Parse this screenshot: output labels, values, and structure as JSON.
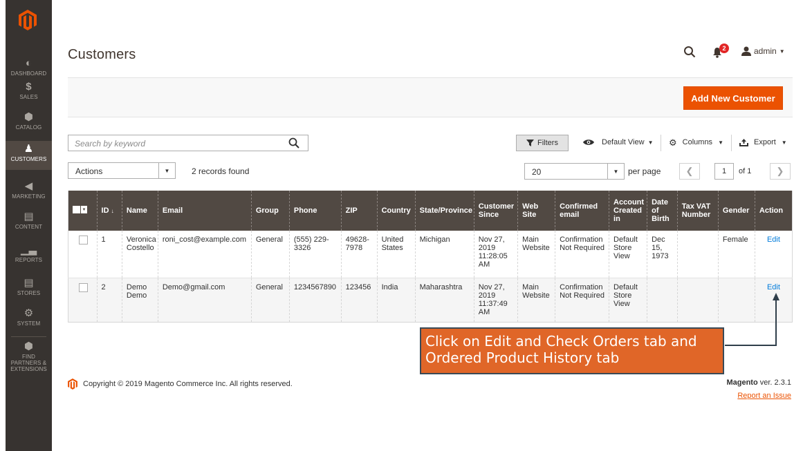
{
  "sidebar": {
    "items": [
      {
        "label": "DASHBOARD",
        "icon": "dashboard-icon"
      },
      {
        "label": "SALES",
        "icon": "dollar-icon"
      },
      {
        "label": "CATALOG",
        "icon": "cube-icon"
      },
      {
        "label": "CUSTOMERS",
        "icon": "person-icon"
      },
      {
        "label": "MARKETING",
        "icon": "megaphone-icon"
      },
      {
        "label": "CONTENT",
        "icon": "layout-icon"
      },
      {
        "label": "REPORTS",
        "icon": "bar-chart-icon"
      },
      {
        "label": "STORES",
        "icon": "storefront-icon"
      },
      {
        "label": "SYSTEM",
        "icon": "gear-icon"
      },
      {
        "label": "FIND PARTNERS & EXTENSIONS",
        "icon": "box-icon"
      }
    ]
  },
  "header": {
    "title": "Customers",
    "notification_count": "2",
    "user": "admin"
  },
  "actions": {
    "add_new": "Add New Customer"
  },
  "toolbar": {
    "search_placeholder": "Search by keyword",
    "filters": "Filters",
    "default_view": "Default View",
    "columns": "Columns",
    "export": "Export",
    "mass_actions": "Actions",
    "records_found": "2 records found",
    "per_page_value": "20",
    "per_page_label": "per page",
    "page_current": "1",
    "page_of": "of 1"
  },
  "grid": {
    "columns": [
      "ID",
      "Name",
      "Email",
      "Group",
      "Phone",
      "ZIP",
      "Country",
      "State/Province",
      "Customer Since",
      "Web Site",
      "Confirmed email",
      "Account Created in",
      "Date of Birth",
      "Tax VAT Number",
      "Gender",
      "Action"
    ],
    "rows": [
      {
        "id": "1",
        "name": "Veronica Costello",
        "email": "roni_cost@example.com",
        "group": "General",
        "phone": "(555) 229-3326",
        "zip": "49628-7978",
        "country": "United States",
        "state": "Michigan",
        "since": "Nov 27, 2019 11:28:05 AM",
        "website": "Main Website",
        "confirmed": "Confirmation Not Required",
        "created_in": "Default Store View",
        "dob": "Dec 15, 1973",
        "taxvat": "",
        "gender": "Female",
        "action": "Edit"
      },
      {
        "id": "2",
        "name": "Demo Demo",
        "email": "Demo@gmail.com",
        "group": "General",
        "phone": "1234567890",
        "zip": "123456",
        "country": "India",
        "state": "Maharashtra",
        "since": "Nov 27, 2019 11:37:49 AM",
        "website": "Main Website",
        "confirmed": "Confirmation Not Required",
        "created_in": "Default Store View",
        "dob": "",
        "taxvat": "",
        "gender": "",
        "action": "Edit"
      }
    ]
  },
  "callout": {
    "text": "Click on Edit and Check Orders tab and Ordered Product History tab"
  },
  "footer": {
    "copyright": "Copyright © 2019 Magento Commerce Inc. All rights reserved.",
    "brand": "Magento",
    "version": " ver. 2.3.1",
    "report": "Report an Issue"
  },
  "colors": {
    "accent": "#eb5202",
    "sidebar": "#373330",
    "grid_header": "#514943",
    "link": "#007bdb",
    "callout_bg": "#e06628"
  }
}
